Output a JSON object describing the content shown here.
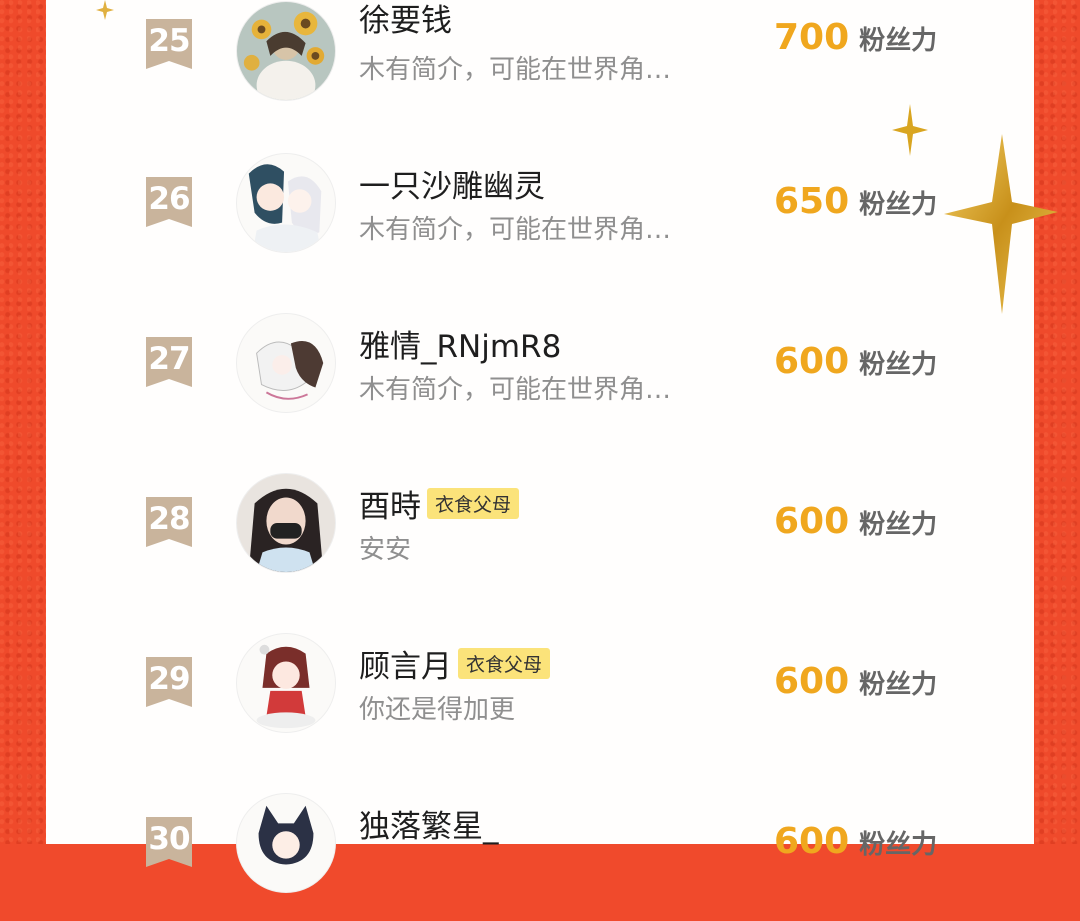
{
  "score_unit": "粉丝力",
  "colors": {
    "background": "#ef4a2b",
    "panel": "#fffefd",
    "score": "#f0a71e",
    "badge": "#c9b49c",
    "tag": "#fbe37a"
  },
  "rows": [
    {
      "rank": "25",
      "name": "徐要钱",
      "tag": "",
      "bio": "木有简介，可能在世界角…",
      "score": "700",
      "avatar": "sunflower-avatar"
    },
    {
      "rank": "26",
      "name": "一只沙雕幽灵",
      "tag": "",
      "bio": "木有简介，可能在世界角…",
      "score": "650",
      "avatar": "anime-couple-avatar"
    },
    {
      "rank": "27",
      "name": "雅情_RNjmR8",
      "tag": "",
      "bio": "木有简介，可能在世界角…",
      "score": "600",
      "avatar": "sketch-avatar"
    },
    {
      "rank": "28",
      "name": "酉時",
      "tag": "衣食父母",
      "bio": "安安",
      "score": "600",
      "avatar": "photo-avatar"
    },
    {
      "rank": "29",
      "name": "顾言月",
      "tag": "衣食父母",
      "bio": "你还是得加更",
      "score": "600",
      "avatar": "chibi-avatar"
    },
    {
      "rank": "30",
      "name": "独落繁星_",
      "tag": "",
      "bio": "",
      "score": "600",
      "avatar": "cat-boy-avatar"
    }
  ]
}
